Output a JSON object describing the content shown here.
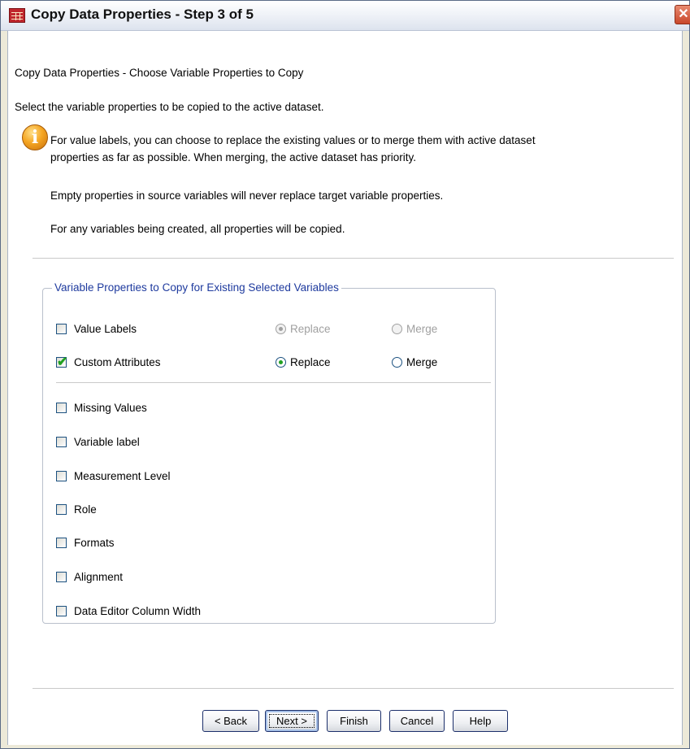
{
  "window": {
    "title": "Copy Data Properties - Step 3 of 5",
    "close_glyph": "✕"
  },
  "content": {
    "heading": "Copy Data Properties - Choose Variable Properties to Copy",
    "instruction": "Select the variable properties to be copied to the active dataset.",
    "info_icon_glyph": "i",
    "info_line1": "For value labels, you can choose to replace the existing values or to merge them with active dataset",
    "info_line2": "properties as far as possible.  When merging, the active dataset has priority.",
    "empty_note": "Empty properties in source variables will never replace target variable properties.",
    "create_note": "For any variables being created, all properties will be copied."
  },
  "group": {
    "title": "Variable Properties to Copy for Existing Selected Variables",
    "value_labels": {
      "label": "Value Labels",
      "checked": false,
      "replace_label": "Replace",
      "merge_label": "Merge",
      "selected": "Replace",
      "enabled": false
    },
    "custom_attributes": {
      "label": "Custom Attributes",
      "checked": true,
      "replace_label": "Replace",
      "merge_label": "Merge",
      "selected": "Replace",
      "enabled": true
    },
    "properties": [
      {
        "label": "Missing Values",
        "checked": false
      },
      {
        "label": "Variable label",
        "checked": false
      },
      {
        "label": "Measurement Level",
        "checked": false
      },
      {
        "label": "Role",
        "checked": false
      },
      {
        "label": "Formats",
        "checked": false
      },
      {
        "label": "Alignment",
        "checked": false
      },
      {
        "label": "Data Editor Column Width",
        "checked": false
      }
    ]
  },
  "buttons": {
    "back": "< Back",
    "next": "Next >",
    "finish": "Finish",
    "cancel": "Cancel",
    "help": "Help"
  },
  "colors": {
    "title_text": "#111111",
    "group_title": "#1e3a9e",
    "check_accent": "#21a121",
    "disabled_text": "#a0a0a0"
  }
}
